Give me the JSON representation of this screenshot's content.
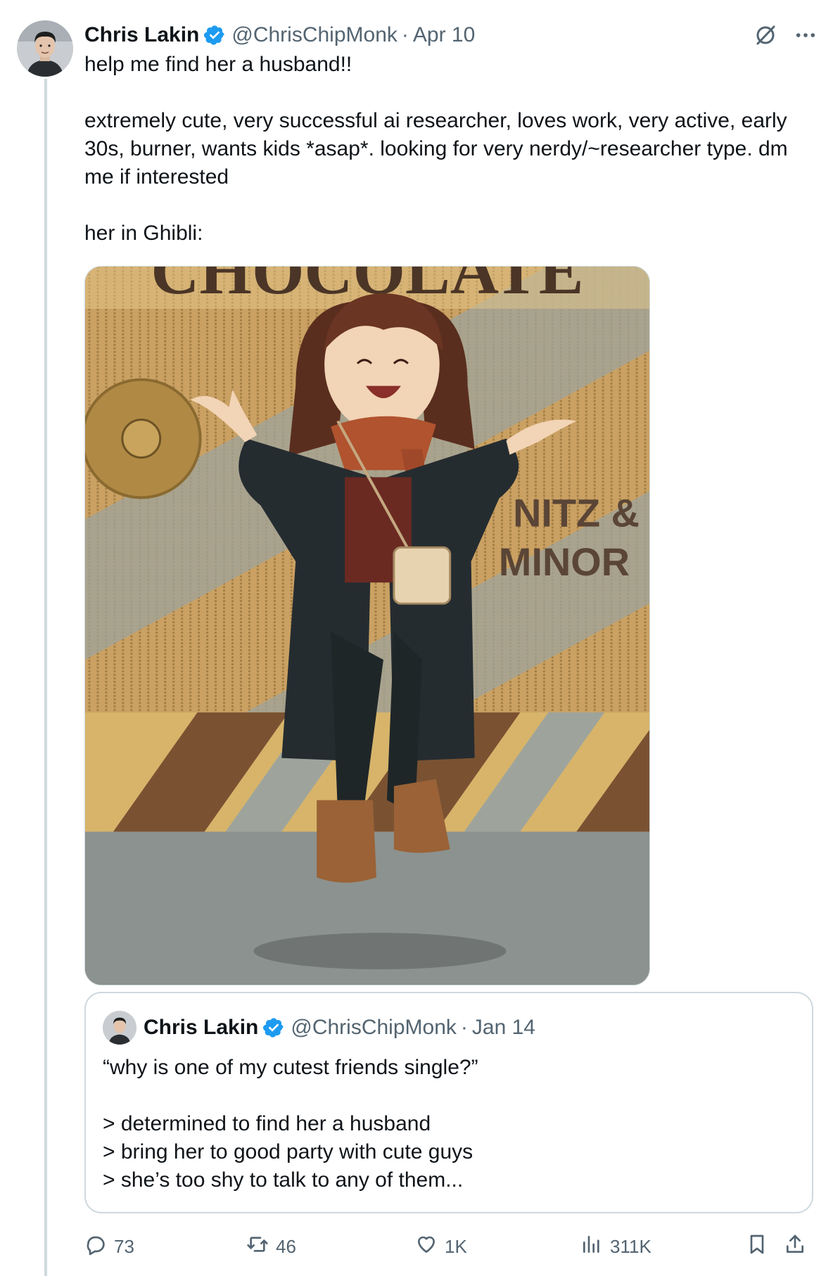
{
  "tweet": {
    "author_name": "Chris Lakin",
    "handle": "@ChrisChipMonk",
    "separator": "·",
    "date": "Apr 10",
    "lines": [
      "help me find her a husband!!",
      "",
      "extremely cute, very successful ai researcher, loves work, very active, early",
      "30s, burner, wants kids *asap*. looking for very nerdy/~researcher type. dm",
      "me if interested",
      "",
      "her in Ghibli:"
    ]
  },
  "media": {
    "sign_top": "CHOCOLATE",
    "sign_right_line1": "NITZ &",
    "sign_right_line2": "MINOR"
  },
  "quote": {
    "author_name": "Chris Lakin",
    "handle": "@ChrisChipMonk",
    "separator": "·",
    "date": "Jan 14",
    "lines": [
      "“why is one of my cutest friends single?”",
      "",
      "> determined to find her a husband",
      "> bring her to good party with cute guys",
      "> she’s too shy to talk to any of them..."
    ]
  },
  "actions": {
    "replies": "73",
    "reposts": "46",
    "likes": "1K",
    "views": "311K"
  },
  "icons": {
    "verified": "verified-badge-icon",
    "grok": "grok-icon",
    "more": "more-icon",
    "reply": "reply-icon",
    "repost": "repost-icon",
    "like": "heart-icon",
    "views": "views-icon",
    "bookmark": "bookmark-icon",
    "share": "share-icon"
  },
  "colors": {
    "verified_blue": "#1d9bf0",
    "secondary_text": "#536471",
    "border": "#cfd9de"
  }
}
